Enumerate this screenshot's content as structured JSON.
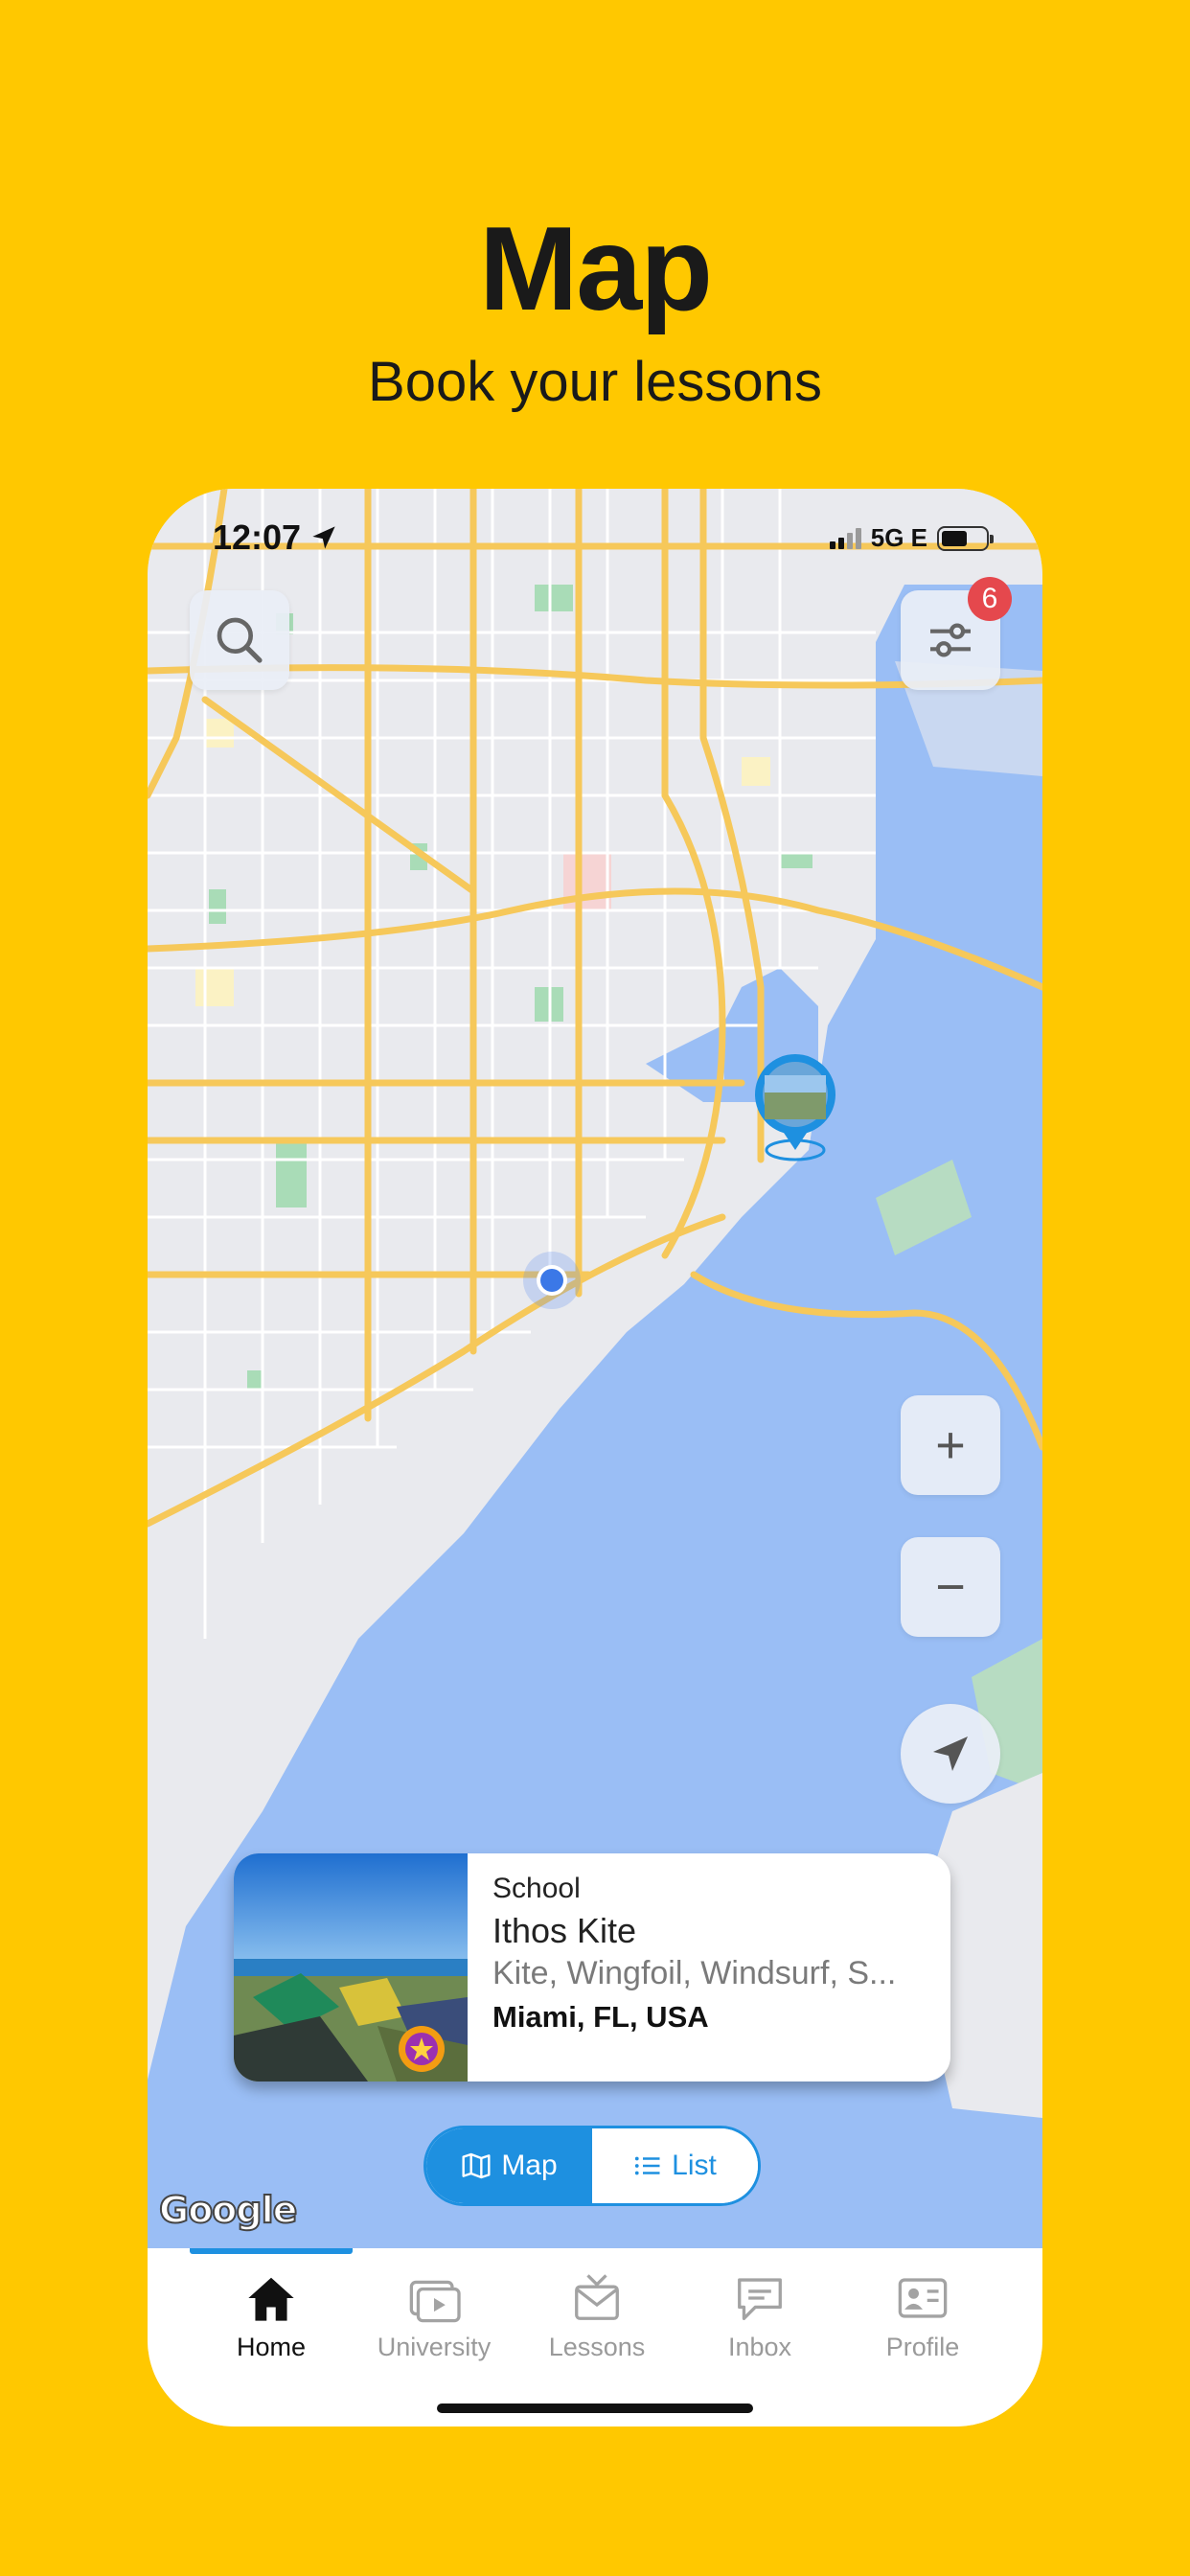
{
  "headline": "Map",
  "subline": "Book your lessons",
  "status_bar": {
    "time": "12:07",
    "network": "5G E"
  },
  "filter_badge": "6",
  "zoom_in": "+",
  "zoom_out": "−",
  "school_card": {
    "type": "School",
    "name": "Ithos Kite",
    "sports": "Kite, Wingfoil, Windsurf, S...",
    "location": "Miami, FL, USA"
  },
  "view_toggle": {
    "map": "Map",
    "list": "List",
    "selected": "map"
  },
  "map_attribution": "Google",
  "tabs": [
    {
      "label": "Home",
      "icon": "home-icon",
      "active": true
    },
    {
      "label": "University",
      "icon": "university-icon"
    },
    {
      "label": "Lessons",
      "icon": "lessons-icon"
    },
    {
      "label": "Inbox",
      "icon": "inbox-icon"
    },
    {
      "label": "Profile",
      "icon": "profile-icon"
    }
  ],
  "colors": {
    "background": "#FFC800",
    "accent": "#1E90E0",
    "water": "#9ABEF5",
    "road": "#F6C85A",
    "badge": "#E5484D"
  }
}
